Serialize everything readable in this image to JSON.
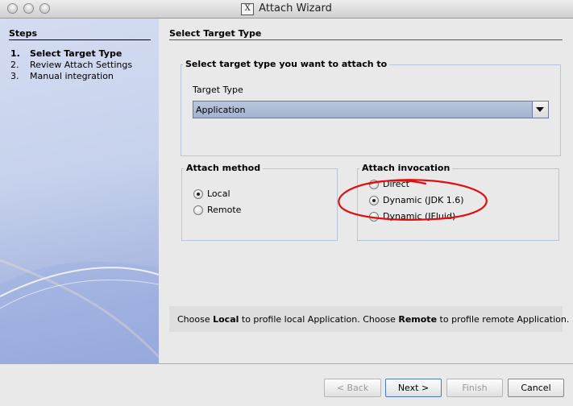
{
  "window": {
    "title": "Attach Wizard"
  },
  "steps": {
    "heading": "Steps",
    "items": [
      {
        "num": "1.",
        "label": "Select Target Type",
        "current": true
      },
      {
        "num": "2.",
        "label": "Review Attach Settings",
        "current": false
      },
      {
        "num": "3.",
        "label": "Manual integration",
        "current": false
      }
    ]
  },
  "page": {
    "title": "Select Target Type",
    "target_group_title": "Select target type you want to attach to",
    "target_type_label": "Target Type",
    "target_type_value": "Application",
    "attach_method": {
      "title": "Attach method",
      "options": [
        {
          "label": "Local",
          "selected": true
        },
        {
          "label": "Remote",
          "selected": false
        }
      ]
    },
    "attach_invocation": {
      "title": "Attach invocation",
      "options": [
        {
          "label": "Direct",
          "selected": false
        },
        {
          "label": "Dynamic (JDK 1.6)",
          "selected": true
        },
        {
          "label": "Dynamic (JFluid)",
          "selected": false
        }
      ]
    },
    "hint": {
      "part1": "Choose ",
      "bold1": "Local",
      "part2": " to profile local Application. Choose ",
      "bold2": "Remote",
      "part3": " to profile remote Application."
    }
  },
  "buttons": {
    "back": "< Back",
    "next": "Next >",
    "finish": "Finish",
    "cancel": "Cancel"
  },
  "colors": {
    "annotation": "#e01010",
    "steps_panel": "#c6d1ec"
  }
}
